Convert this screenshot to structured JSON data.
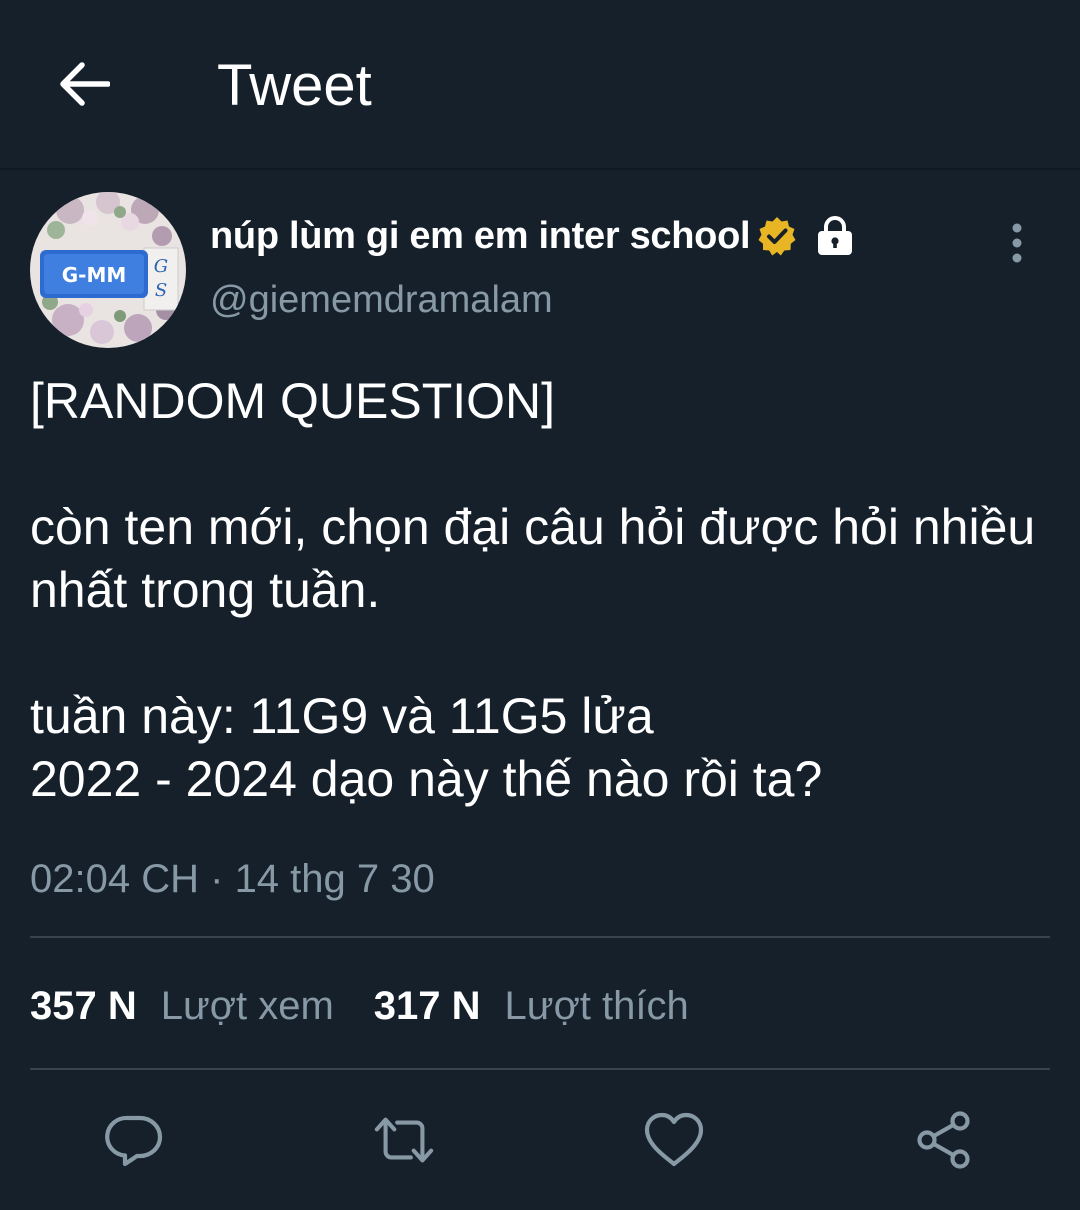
{
  "header": {
    "title": "Tweet",
    "back_icon": "arrow-left-icon"
  },
  "author": {
    "display_name": "núp lùm gi em em inter school",
    "username": "@giememdramalam",
    "verified_color": "#f5c542",
    "avatar_text": "G-MM",
    "avatar_side_text": "G S"
  },
  "tweet": {
    "line1": "[RANDOM QUESTION]",
    "line2": "còn ten mới, chọn đại câu hỏi được hỏi nhiều nhất trong tuần.",
    "line3": "tuần này: 11G9 và 11G5 lửa",
    "line4": "2022 - 2024 dạo này thế nào rồi ta?"
  },
  "meta": {
    "time": "02:04 CH",
    "separator": "·",
    "date": "14 thg 7 30"
  },
  "stats": {
    "views_count": "357 N",
    "views_label": "Lượt xem",
    "likes_count": "317 N",
    "likes_label": "Lượt thích"
  },
  "actions": {
    "reply_icon": "reply-icon",
    "retweet_icon": "retweet-icon",
    "like_icon": "heart-icon",
    "share_icon": "share-icon"
  },
  "colors": {
    "background": "#15202b",
    "secondary_text": "#8899a6",
    "divider": "#38444d"
  }
}
